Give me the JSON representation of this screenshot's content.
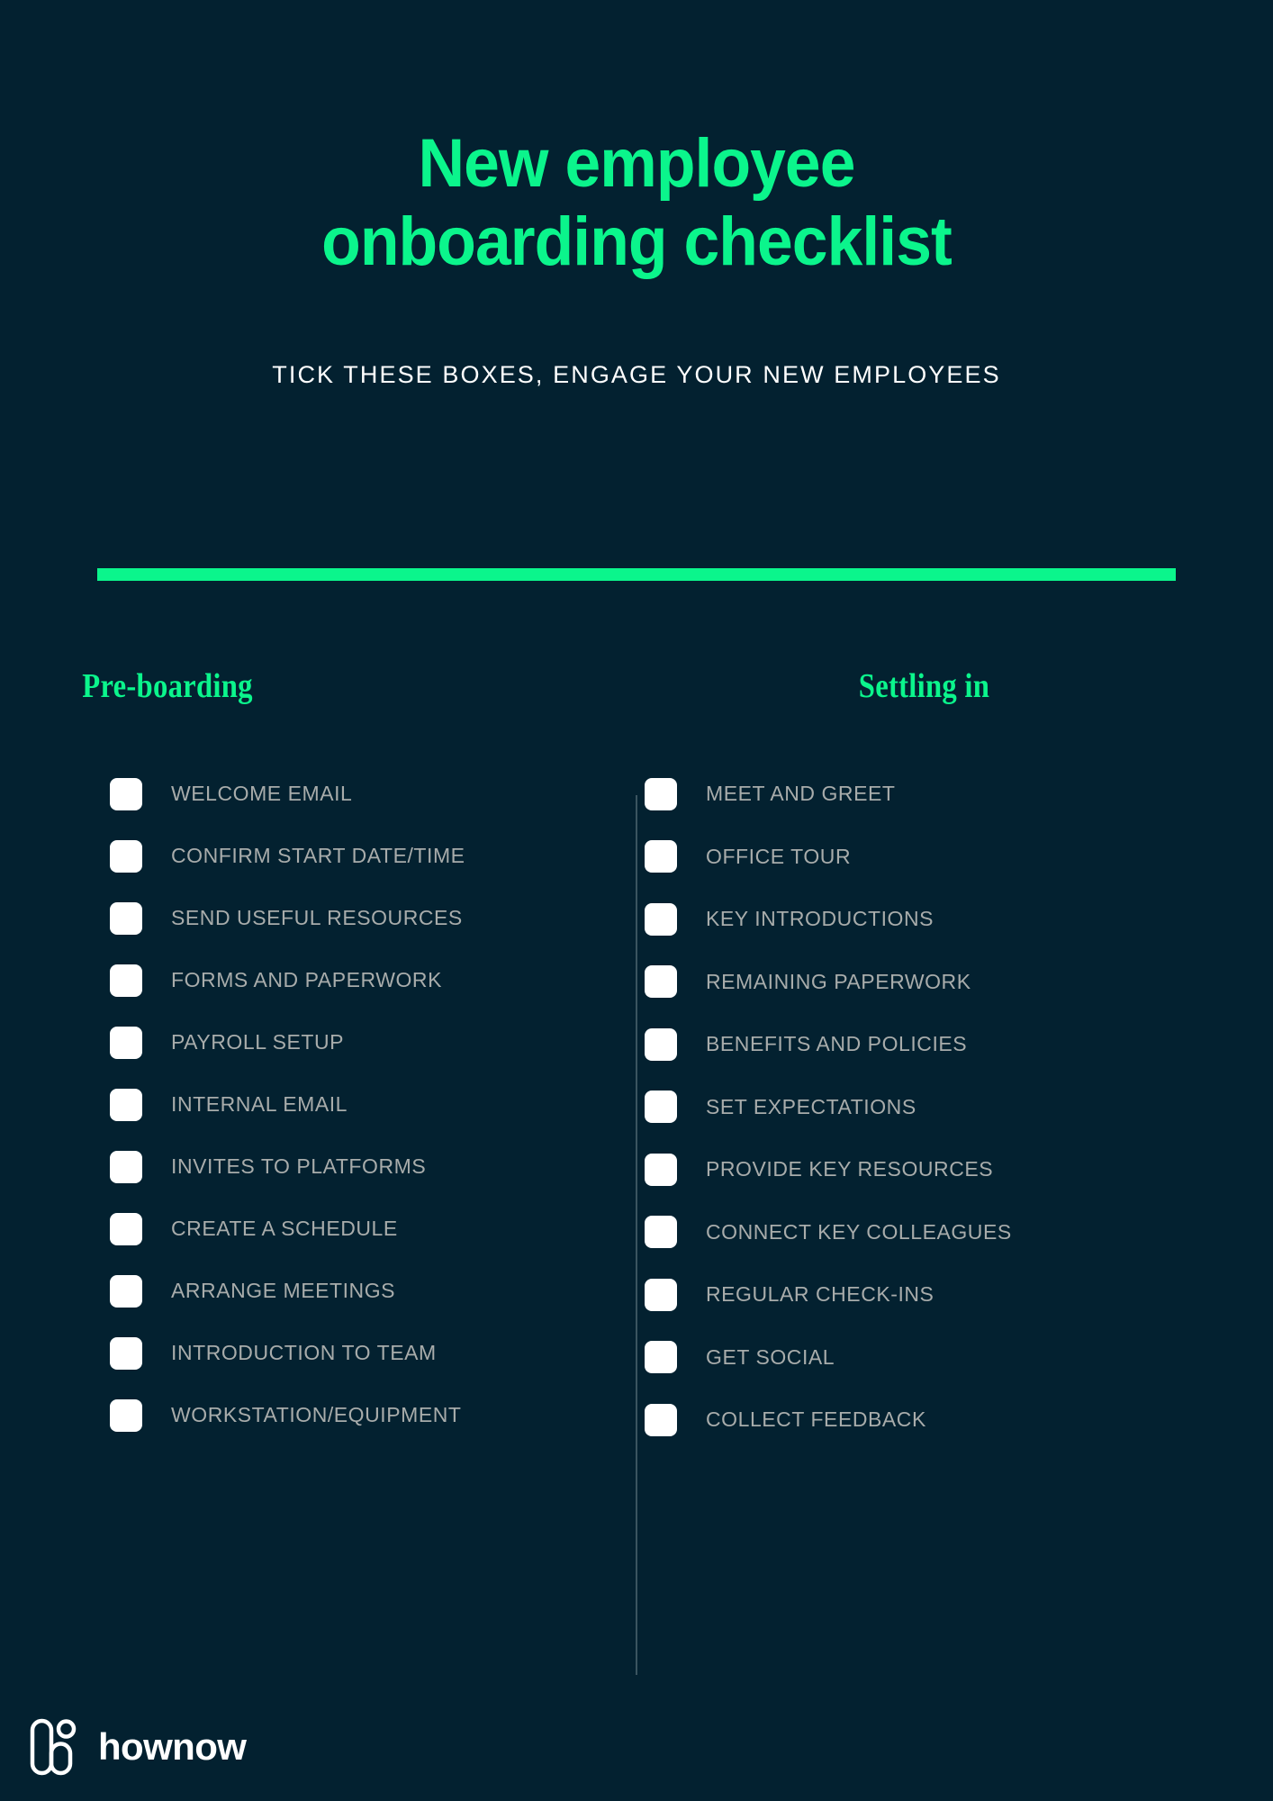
{
  "header": {
    "title": "New employee\nonboarding checklist",
    "subtitle": "Tick these boxes, engage your new employees"
  },
  "colors": {
    "background": "#032130",
    "accent_green": "#0BF58C",
    "label_grey": "#A8ACAB",
    "checkbox_white": "#FFFFFF",
    "divider": "#3B5460"
  },
  "columns": [
    {
      "heading": "Pre-boarding",
      "items": [
        {
          "label": "Welcome email",
          "checked": false
        },
        {
          "label": "Confirm start date/time",
          "checked": false
        },
        {
          "label": "Send useful resources",
          "checked": false
        },
        {
          "label": "Forms and paperwork",
          "checked": false
        },
        {
          "label": "Payroll setup",
          "checked": false
        },
        {
          "label": "Internal email",
          "checked": false
        },
        {
          "label": "Invites to platforms",
          "checked": false
        },
        {
          "label": "Create a schedule",
          "checked": false
        },
        {
          "label": "Arrange meetings",
          "checked": false
        },
        {
          "label": "Introduction to team",
          "checked": false
        },
        {
          "label": "Workstation/equipment",
          "checked": false
        }
      ]
    },
    {
      "heading": "Settling in",
      "items": [
        {
          "label": "Meet and greet",
          "checked": false
        },
        {
          "label": "Office tour",
          "checked": false
        },
        {
          "label": "Key introductions",
          "checked": false
        },
        {
          "label": "Remaining paperwork",
          "checked": false
        },
        {
          "label": "Benefits and policies",
          "checked": false
        },
        {
          "label": "Set expectations",
          "checked": false
        },
        {
          "label": "Provide key resources",
          "checked": false
        },
        {
          "label": "Connect key colleagues",
          "checked": false
        },
        {
          "label": "Regular check-ins",
          "checked": false
        },
        {
          "label": "Get social",
          "checked": false
        },
        {
          "label": "Collect feedback",
          "checked": false
        }
      ]
    }
  ],
  "footer": {
    "logo_wordmark": "hownow",
    "logo_icon": "hownow-h-mark-icon"
  }
}
